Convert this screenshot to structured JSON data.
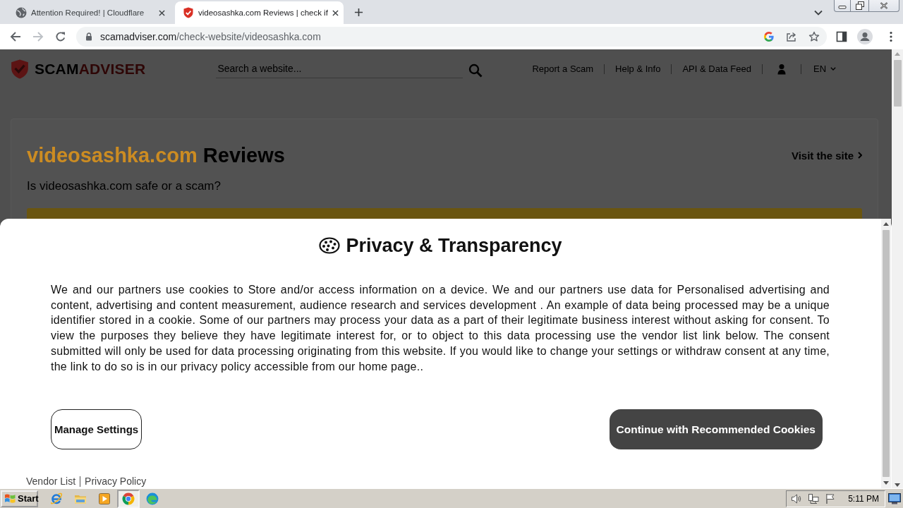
{
  "browser": {
    "tabs": [
      {
        "title": "Attention Required! | Cloudflare",
        "selected": false
      },
      {
        "title": "videosashka.com Reviews | check if",
        "selected": true
      }
    ],
    "back": {
      "disabled": false
    },
    "forward": {
      "disabled": true
    },
    "address": {
      "host": "scamadviser.com",
      "path": "/check-website/videosashka.com"
    }
  },
  "page": {
    "logo": [
      "SCAM",
      "ADVISER"
    ],
    "search": {
      "placeholder": "Search a website..."
    },
    "nav": {
      "links": [
        "Report a Scam",
        "Help & Info",
        "API & Data Feed"
      ],
      "language": "EN"
    },
    "heading": {
      "domain": "videosashka.com",
      "text": "Reviews"
    },
    "visit_link": "Visit the site",
    "subtitle": "Is videosashka.com safe or a scam?"
  },
  "consent_dialog": {
    "title": "Privacy & Transparency",
    "body": "We and our partners use cookies to Store and/or access information on a device. We and our partners use data for Personalised advertising and content, advertising and content measurement, audience research and services development . An example of data being processed may be a unique identifier stored in a cookie. Some of our partners may process your data as a part of their legitimate business interest without asking for consent. To view the purposes they believe they have legitimate interest for, or to object to this data processing use the vendor list link below. The consent submitted will only be used for data processing originating from this website. If you would like to change your settings or withdraw consent at any time, the link to do so is in our privacy policy accessible from our home page..",
    "buttons": [
      {
        "label": "Manage Settings",
        "kind": "secondary"
      },
      {
        "label": "Continue with Recommended Cookies",
        "kind": "primary"
      }
    ],
    "links": [
      "Vendor List",
      "Privacy Policy"
    ]
  },
  "taskbar": {
    "start": "Start",
    "apps": [
      {
        "selected": false
      },
      {
        "selected": false
      },
      {
        "selected": false
      },
      {
        "selected": true
      },
      {
        "selected": false
      }
    ],
    "clock": "5:11 PM"
  }
}
